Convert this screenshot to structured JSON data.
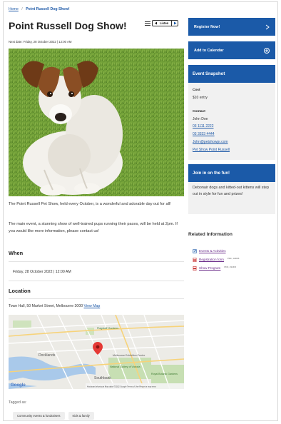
{
  "breadcrumb": {
    "home": "Home",
    "separator": "/",
    "current": "Point Russell Dog Show!"
  },
  "page_title": "Point Russell Dog Show!",
  "listen_widget": {
    "label": "Listen",
    "menu_icon": "menu-icon",
    "speaker_icon": "speaker-icon",
    "play_icon": "play-icon"
  },
  "next_date": "Next date: Friday, 28 October 2022 | 12:00 AM",
  "hero_image": {
    "subject": "jack-russell-dog-photo"
  },
  "description": [
    "The Point Russell Pet Show, held every October, is a wonderful and adorable day out for all!",
    "The main event, a stunning show of well-trained pups running their paces, will be held at 2pm. If you would like more information, please contact us!"
  ],
  "when": {
    "heading": "When",
    "value": "Friday, 28 October 2022 | 12:00 AM"
  },
  "location": {
    "heading": "Location",
    "address": "Town Hall, 50 Market Street, Melbourne 3000",
    "map_link": "View Map",
    "map_labels": [
      "Docklands",
      "Southbank",
      "Flagstaff Gardens",
      "National Gallery of Victoria",
      "Melbourne Exhibition Centre",
      "Royal Botanic Gardens"
    ],
    "map_attribution": "Keyboard shortcuts   Map data ©2022 Google   Terms of Use   Report a map error",
    "map_brand": "Google"
  },
  "tagged": {
    "label": "Tagged as:",
    "tags": [
      "Community events & fundraisers",
      "Kids & family"
    ]
  },
  "sidebar": {
    "register_button": "Register Now!",
    "calendar_button": "Add to Calendar",
    "snapshot": {
      "heading": "Event Snapshot",
      "cost_label": "Cost",
      "cost_value": "$10 entry",
      "contact_label": "Contact",
      "contact_name": "John Doe",
      "phone1": "03 1111 2222",
      "phone2": "03 3333 4444",
      "email": "John@petshowpr.com",
      "website": "Pet Show Point Russell"
    },
    "fun": {
      "heading": "Join in on the fun!",
      "text": "Debonair dogs and kitted-out kittens will step out in style for fun and prizes!"
    },
    "related": {
      "heading": "Related Information",
      "items": [
        {
          "label": "Events & Activities",
          "meta": "",
          "icon": "link-icon"
        },
        {
          "label": "Registration form",
          "meta": "PDF, 123KB",
          "icon": "pdf-icon"
        },
        {
          "label": "Show Program",
          "meta": "PDF, 234KB",
          "icon": "pdf-icon"
        }
      ]
    }
  },
  "colors": {
    "primary": "#1b5aa8",
    "sidebar_bg": "#f1f1f1",
    "link": "#1f5aa8",
    "visited_link": "#6b2d8a"
  }
}
